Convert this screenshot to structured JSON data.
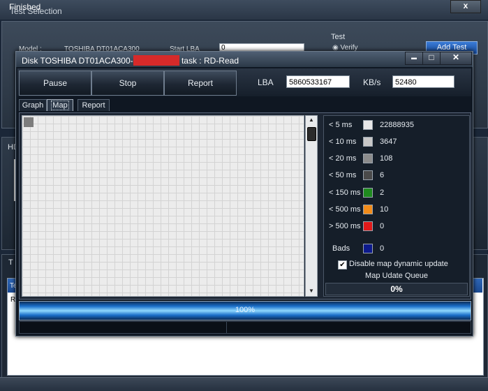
{
  "bg_window": {
    "title": "Test Selection",
    "close": "x",
    "model_label": "Model :",
    "model_value": "TOSHIBA DT01ACA300",
    "start_lba_label": "Start LBA",
    "start_lba_value": "0",
    "test_group_label": "Test",
    "verify_label": "Verify",
    "add_test_label": "Add Test",
    "hd_label": "HD",
    "t_label": "T",
    "te_label": "Te",
    "r_label": "R"
  },
  "status": {
    "text": "Finished"
  },
  "dialog": {
    "title_prefix": "Disk TOSHIBA DT01ACA300-",
    "title_suffix": "task : RD-Read",
    "min": "▬",
    "max": "□",
    "close": "✕",
    "buttons": {
      "pause": "Pause",
      "stop": "Stop",
      "report": "Report"
    },
    "lba_label": "LBA",
    "lba_value": "5860533167",
    "speed_label": "KB/s",
    "speed_value": "52480",
    "tabs": {
      "graph": "Graph",
      "map": "Map",
      "report": "Report"
    },
    "legend": [
      {
        "label": "< 5 ms",
        "count": "22888935",
        "color": "#e8e8e8"
      },
      {
        "label": "< 10 ms",
        "count": "3647",
        "color": "#c8c8c8"
      },
      {
        "label": "< 20 ms",
        "count": "108",
        "color": "#8c8c8c"
      },
      {
        "label": "< 50 ms",
        "count": "6",
        "color": "#4a4a4a"
      },
      {
        "label": "< 150 ms",
        "count": "2",
        "color": "#1f8a1f"
      },
      {
        "label": "< 500 ms",
        "count": "10",
        "color": "#f28c1a"
      },
      {
        "label": "> 500 ms",
        "count": "0",
        "color": "#e01a1a"
      }
    ],
    "bads": {
      "label": "Bads",
      "count": "0",
      "color": "#0d1a8c"
    },
    "disable_map_label": "Disable map dynamic update",
    "disable_map_checked": true,
    "check_mark": "✔",
    "queue_label": "Map Udate Queue",
    "queue_percent": "0%",
    "progress_text": "100%",
    "progress_value": 1.0
  }
}
